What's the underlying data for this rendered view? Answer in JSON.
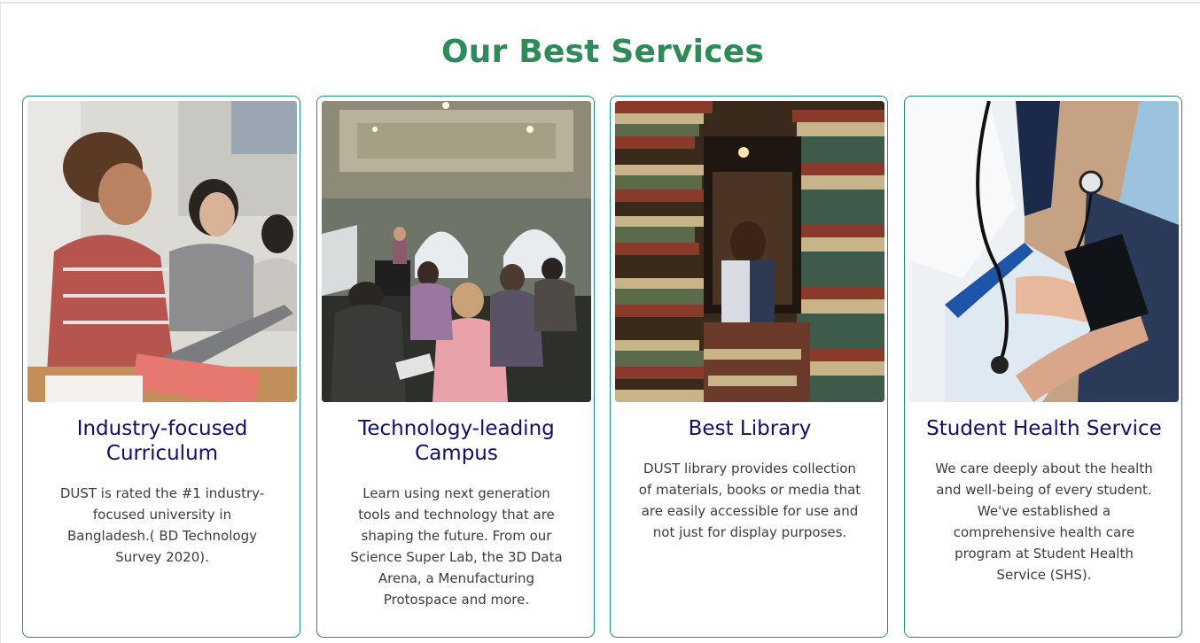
{
  "section": {
    "title": "Our Best Services"
  },
  "cards": [
    {
      "title": "Industry-focused Curriculum",
      "text": "DUST is rated the #1 industry-focused university in Bangladesh.( BD Technology Survey 2020).",
      "image": "students-with-laptop-photo"
    },
    {
      "title": "Technology-leading Campus",
      "text": "Learn using next generation tools and technology that are shaping the future. From our Science Super Lab, the 3D Data Arena, a Menufacturing Protospace and more.",
      "image": "classroom-lecture-photo"
    },
    {
      "title": "Best Library",
      "text": "DUST library provides collection of materials, books or media that are easily accessible for use and not just for display purposes.",
      "image": "library-books-photo"
    },
    {
      "title": "Student Health Service",
      "text": "We care deeply about the health and well-being of every student. We've established a comprehensive health care program at Student Health Service (SHS).",
      "image": "blood-pressure-check-photo"
    }
  ],
  "colors": {
    "heading": "#2e8b57",
    "card_title": "#0e0e6e",
    "card_border": "#1b8f7e",
    "body_text": "#3c3c3c"
  }
}
